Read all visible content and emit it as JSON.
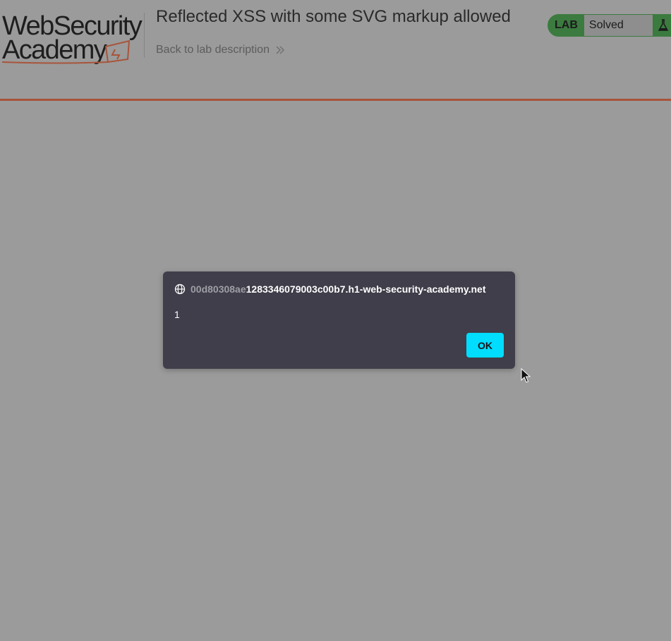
{
  "header": {
    "logo": {
      "line1": "WebSecurity",
      "line2": "Academy"
    },
    "title": "Reflected XSS with some SVG markup allowed",
    "back_link": "Back to lab description",
    "status": {
      "badge": "LAB",
      "value": "Solved",
      "icon": "flask-icon"
    }
  },
  "dialog": {
    "origin_faded": "00d80308ae",
    "origin_rest": "1283346079003c00b7.h1-web-security-academy.net",
    "message": "1",
    "ok_label": "OK",
    "icon": "globe-icon"
  },
  "colors": {
    "overlay_bg": "#9b9b9b",
    "header_rule": "#a8553a",
    "lab_green": "#3b7b3f",
    "dialog_bg": "#3f3e4a",
    "ok_button": "#00ddff"
  }
}
